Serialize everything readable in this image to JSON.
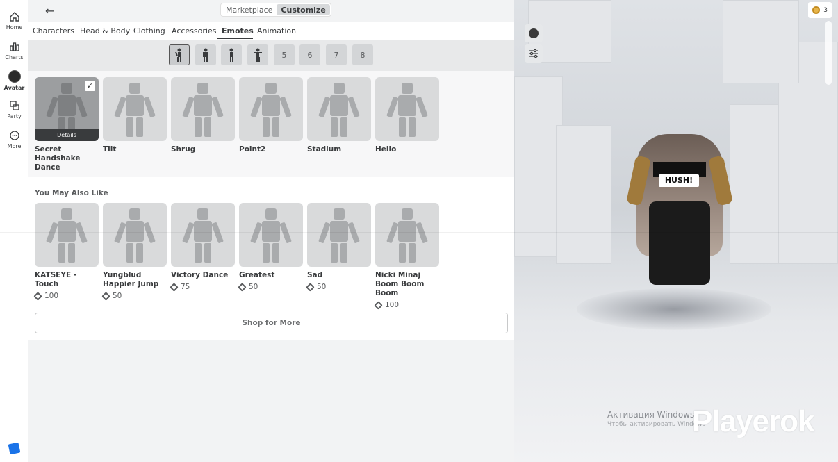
{
  "nav": {
    "items": [
      {
        "label": "Home",
        "icon": "home-icon"
      },
      {
        "label": "Charts",
        "icon": "charts-icon"
      },
      {
        "label": "Avatar",
        "icon": "avatar-icon"
      },
      {
        "label": "Party",
        "icon": "party-icon"
      },
      {
        "label": "More",
        "icon": "more-icon"
      }
    ]
  },
  "topbar": {
    "back": "←",
    "segments": [
      "Marketplace",
      "Customize"
    ],
    "active_segment": "Customize"
  },
  "tabs": [
    "Characters",
    "Head & Body",
    "Clothing",
    "Accessories",
    "Emotes",
    "Animation"
  ],
  "active_tab": "Emotes",
  "slots": [
    "",
    "",
    "",
    "",
    "5",
    "6",
    "7",
    "8"
  ],
  "emotes": [
    {
      "name": "Secret Handshake Dance",
      "equipped": true,
      "overlay": "Details"
    },
    {
      "name": "Tilt"
    },
    {
      "name": "Shrug"
    },
    {
      "name": "Point2"
    },
    {
      "name": "Stadium"
    },
    {
      "name": "Hello"
    }
  ],
  "recommend": {
    "title": "You May Also Like",
    "items": [
      {
        "name": "KATSEYE - Touch",
        "price": "100"
      },
      {
        "name": "Yungblud Happier Jump",
        "price": "50"
      },
      {
        "name": "Victory Dance",
        "price": "75"
      },
      {
        "name": "Greatest",
        "price": "50"
      },
      {
        "name": "Sad",
        "price": "50"
      },
      {
        "name": "Nicki Minaj Boom Boom Boom",
        "price": "100"
      }
    ],
    "shop_more": "Shop for More"
  },
  "viewport": {
    "currency_count": "3",
    "hush_text": "HUSH!",
    "watermark_title": "Активация Windows",
    "watermark_sub": "Чтобы активировать Windows",
    "brand": "Playerok"
  },
  "colors": {
    "accent": "#393b3d",
    "panel": "#f2f3f4",
    "coin": "#e6b44a"
  }
}
